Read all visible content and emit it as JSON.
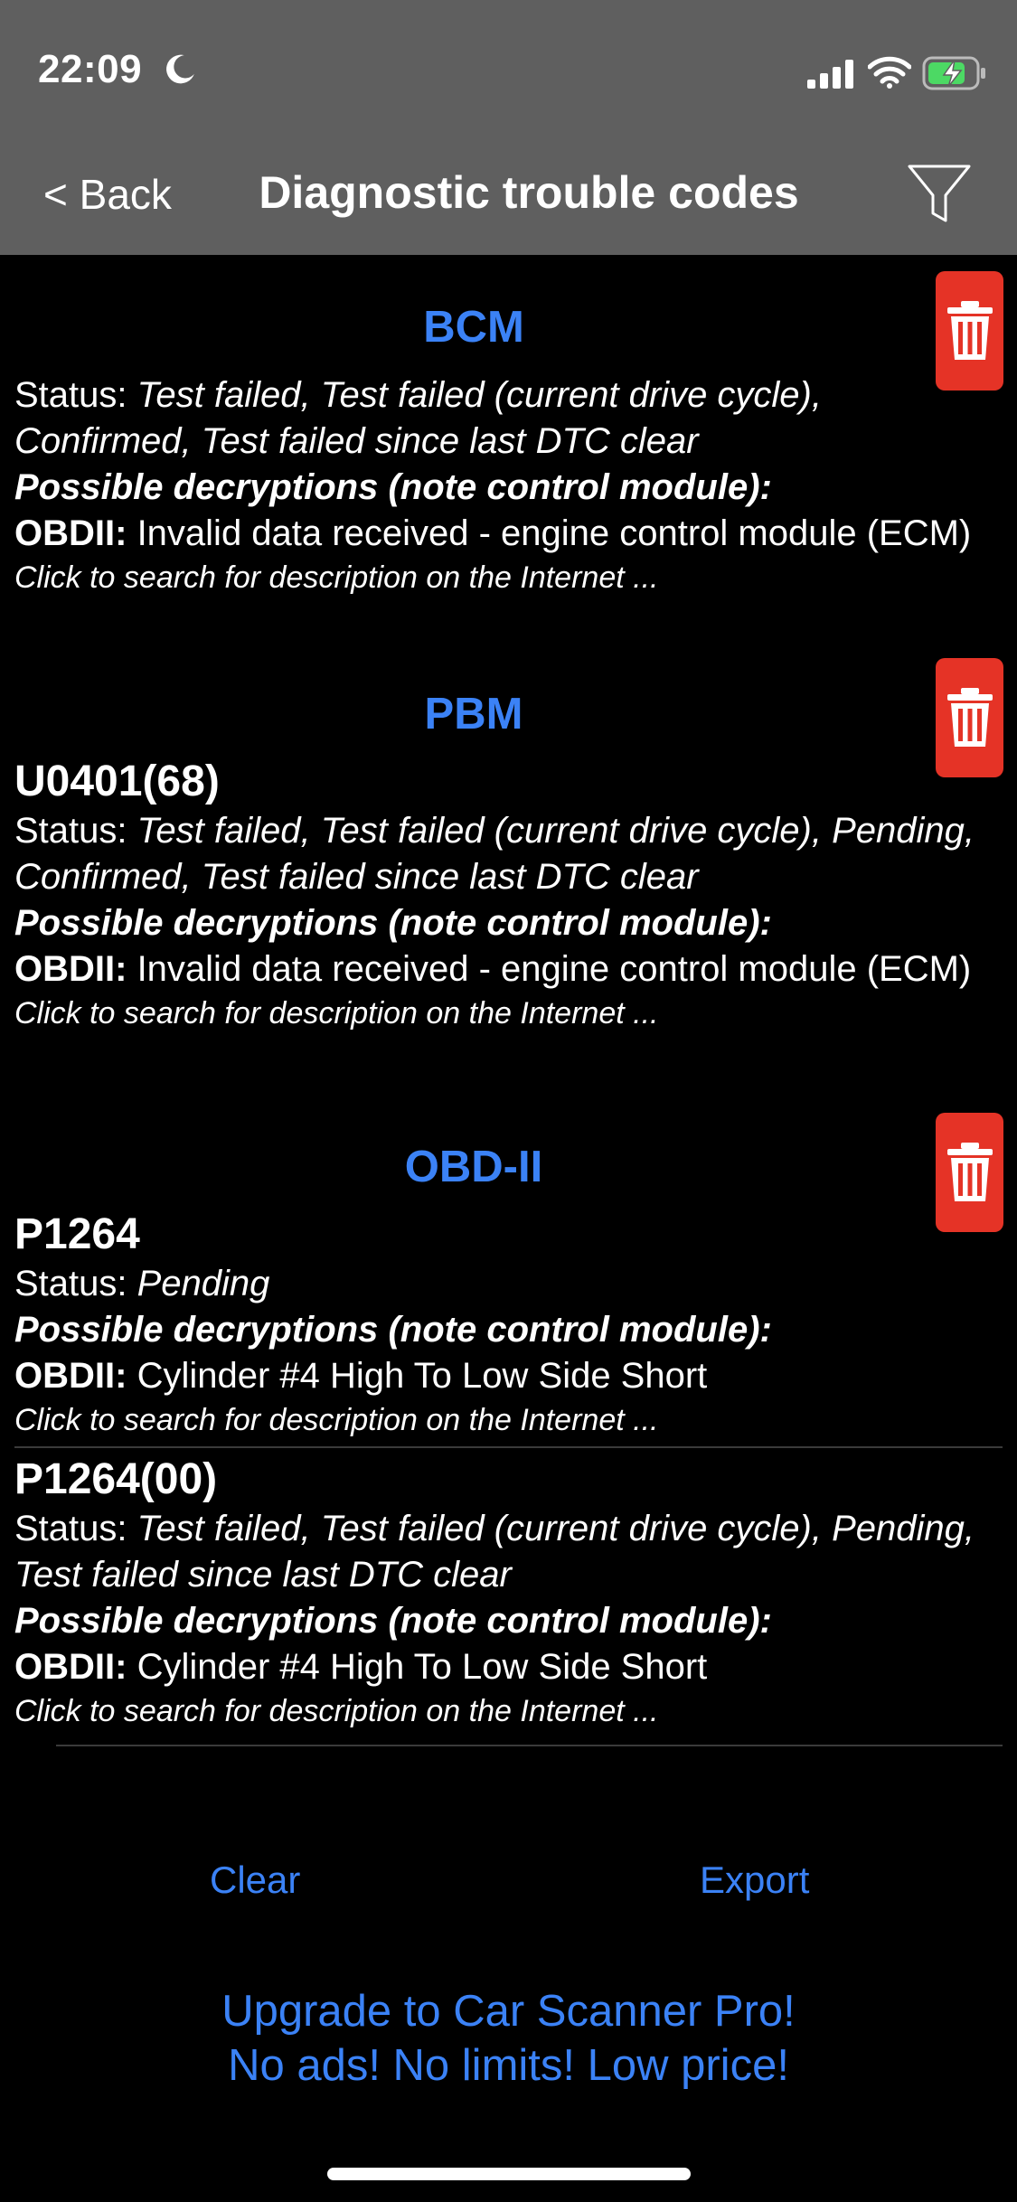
{
  "status_bar": {
    "time": "22:09"
  },
  "nav": {
    "back_label": "< Back",
    "title": "Diagnostic trouble codes"
  },
  "labels": {
    "status_prefix": "Status: ",
    "possible_heading": "Possible decryptions (note control module):",
    "obdii_prefix": "OBDII:",
    "search_link": "Click to search for description on the Internet ..."
  },
  "sections": [
    {
      "module": "BCM",
      "codes": [
        {
          "code": "",
          "status": "Test failed, Test failed (current drive cycle), Confirmed, Test failed since last DTC clear",
          "description": "Invalid data received - engine control module (ECM)"
        }
      ]
    },
    {
      "module": "PBM",
      "codes": [
        {
          "code": "U0401(68)",
          "status": "Test failed, Test failed (current drive cycle), Pending, Confirmed, Test failed since last DTC clear",
          "description": "Invalid data received - engine control module (ECM)"
        }
      ]
    },
    {
      "module": "OBD-II",
      "codes": [
        {
          "code": "P1264",
          "status": "Pending",
          "description": "Cylinder #4 High To Low Side Short"
        },
        {
          "code": "P1264(00)",
          "status": "Test failed, Test failed (current drive cycle), Pending, Test failed since last DTC clear",
          "description": "Cylinder #4 High To Low Side Short"
        }
      ]
    }
  ],
  "actions": {
    "clear_label": "Clear",
    "export_label": "Export"
  },
  "upgrade": {
    "line1": "Upgrade to Car Scanner Pro!",
    "line2": "No ads! No limits! Low price!"
  }
}
